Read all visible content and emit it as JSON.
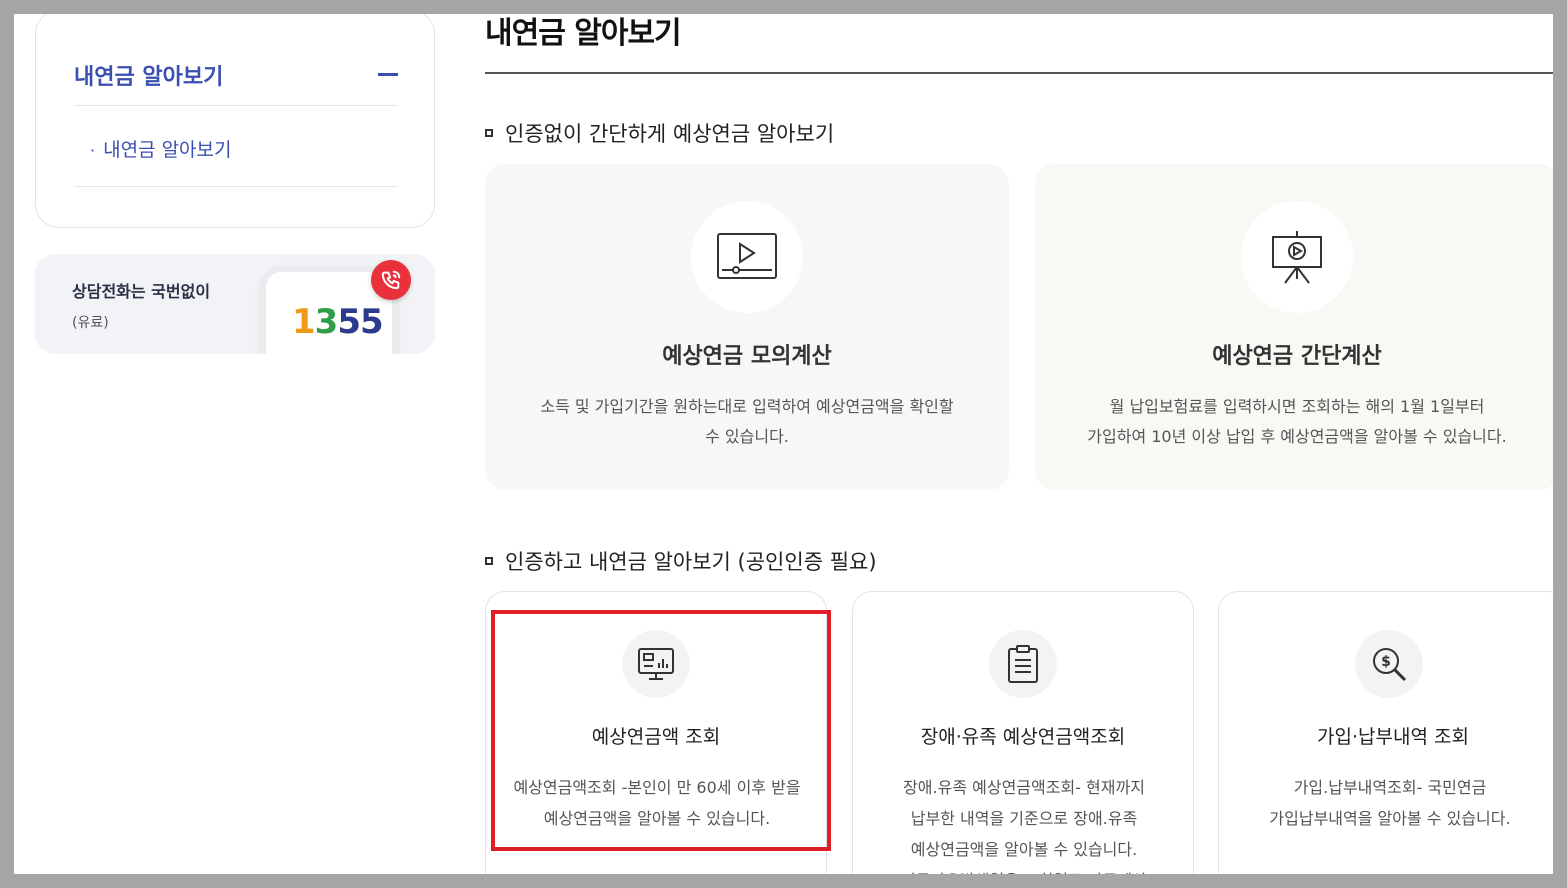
{
  "sidebar": {
    "menu_title": "내연금 알아보기",
    "sub_item": "내연금 알아보기",
    "call_title": "상담전화는 국번없이",
    "call_sub": "(유료)",
    "phone_d1": "1",
    "phone_d2": "3",
    "phone_d3": "55"
  },
  "main": {
    "title": "내연금 알아보기",
    "section1": "인증없이 간단하게 예상연금 알아보기",
    "section2": "인증하고 내연금 알아보기 (공인인증 필요)"
  },
  "big_cards": [
    {
      "title": "예상연금 모의계산",
      "desc1": "소득 및 가입기간을 원하는대로 입력하여 예상연금액을 확인할",
      "desc2": "수 있습니다.",
      "icon": "video-player-icon"
    },
    {
      "title": "예상연금 간단계산",
      "desc1": "월 납입보험료를 입력하시면 조회하는 해의 1월 1일부터",
      "desc2": "가입하여 10년 이상 납입 후 예상연금액을 알아볼 수 있습니다.",
      "icon": "presentation-board-icon"
    }
  ],
  "small_cards": [
    {
      "title": "예상연금액 조회",
      "desc1": "예상연금액조회 -본인이 만 60세 이후 받을",
      "desc2": "예상연금액을 알아볼 수 있습니다.",
      "desc3": "",
      "desc4": "",
      "icon": "monitor-chart-icon"
    },
    {
      "title": "장애·유족 예상연금액조회",
      "desc1": "장애.유족 예상연금액조회- 현재까지",
      "desc2": "납부한 내역을 기준으로 장애.유족",
      "desc3": "예상연금액을 알아볼 수 있습니다.",
      "desc4": "(지급사유발생일은 조회일로 자동계산)",
      "icon": "clipboard-list-icon"
    },
    {
      "title": "가입·납부내역 조회",
      "desc1": "가입.납부내역조회- 국민연금",
      "desc2": "가입납부내역을 알아볼 수 있습니다.",
      "desc3": "",
      "desc4": "",
      "icon": "dollar-search-icon"
    }
  ],
  "colors": {
    "accent": "#3a4fb2",
    "highlight": "#e01e26",
    "call_red": "#e8313a"
  }
}
